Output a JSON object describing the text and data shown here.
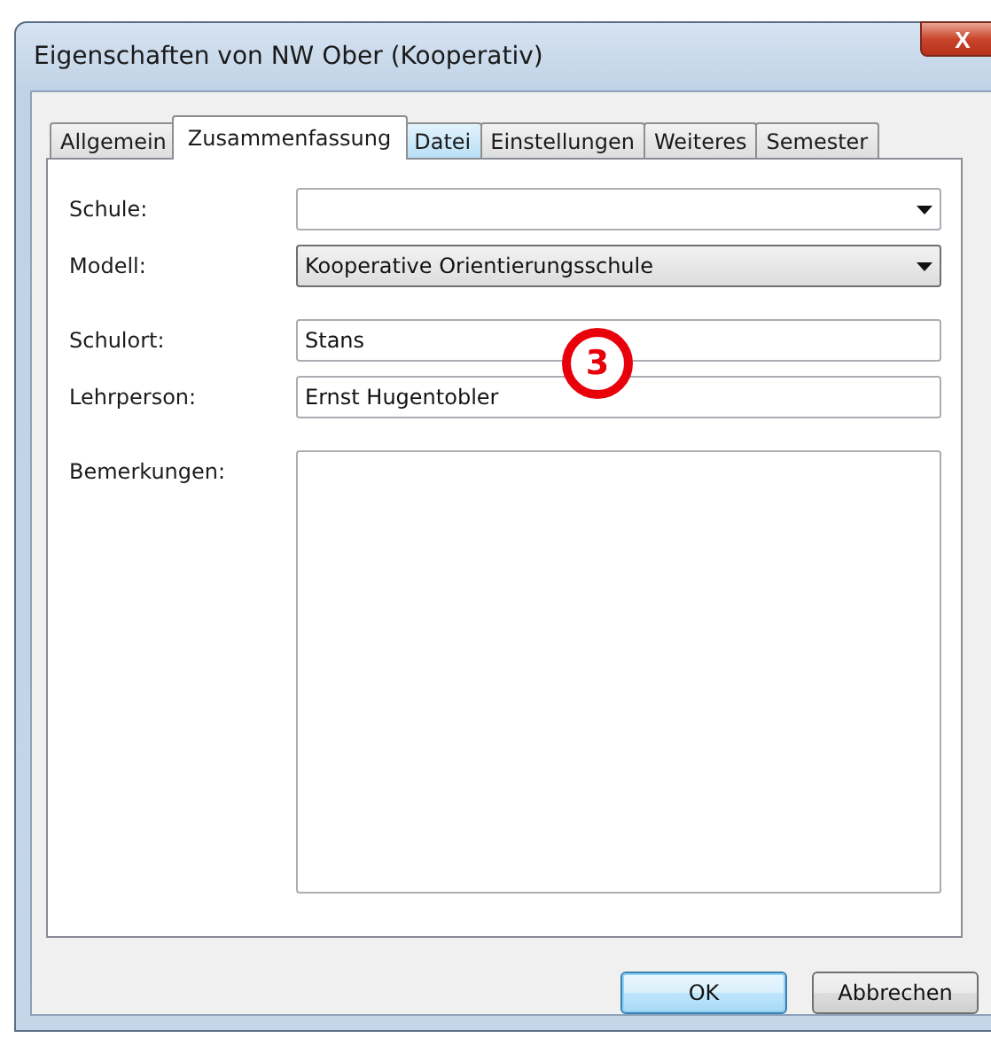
{
  "window": {
    "title": "Eigenschaften von NW Ober (Kooperativ)",
    "close": "X"
  },
  "tabs": [
    {
      "label": "Allgemein",
      "selected": false,
      "hovered": false
    },
    {
      "label": "Zusammenfassung",
      "selected": true,
      "hovered": false
    },
    {
      "label": "Datei",
      "selected": false,
      "hovered": true
    },
    {
      "label": "Einstellungen",
      "selected": false,
      "hovered": false
    },
    {
      "label": "Weiteres",
      "selected": false,
      "hovered": false
    },
    {
      "label": "Semester",
      "selected": false,
      "hovered": false
    }
  ],
  "groups": [
    [
      {
        "label": "Schule:",
        "kind": "combo"
      },
      {
        "label": "Modell:",
        "kind": "dropdown",
        "value": "Kooperative Orientierungsschule"
      }
    ],
    [
      {
        "label": "Schulort:",
        "kind": "text",
        "value": "Stans"
      },
      {
        "label": "Lehrperson:",
        "kind": "text",
        "value": "Ernst Hugentobler"
      }
    ],
    [
      {
        "label": "Bemerkungen:",
        "kind": "textarea"
      }
    ]
  ],
  "callout": {
    "text": "3"
  },
  "buttons": [
    {
      "label": "OK",
      "default": true
    },
    {
      "label": "Abbrechen",
      "default": false
    }
  ]
}
